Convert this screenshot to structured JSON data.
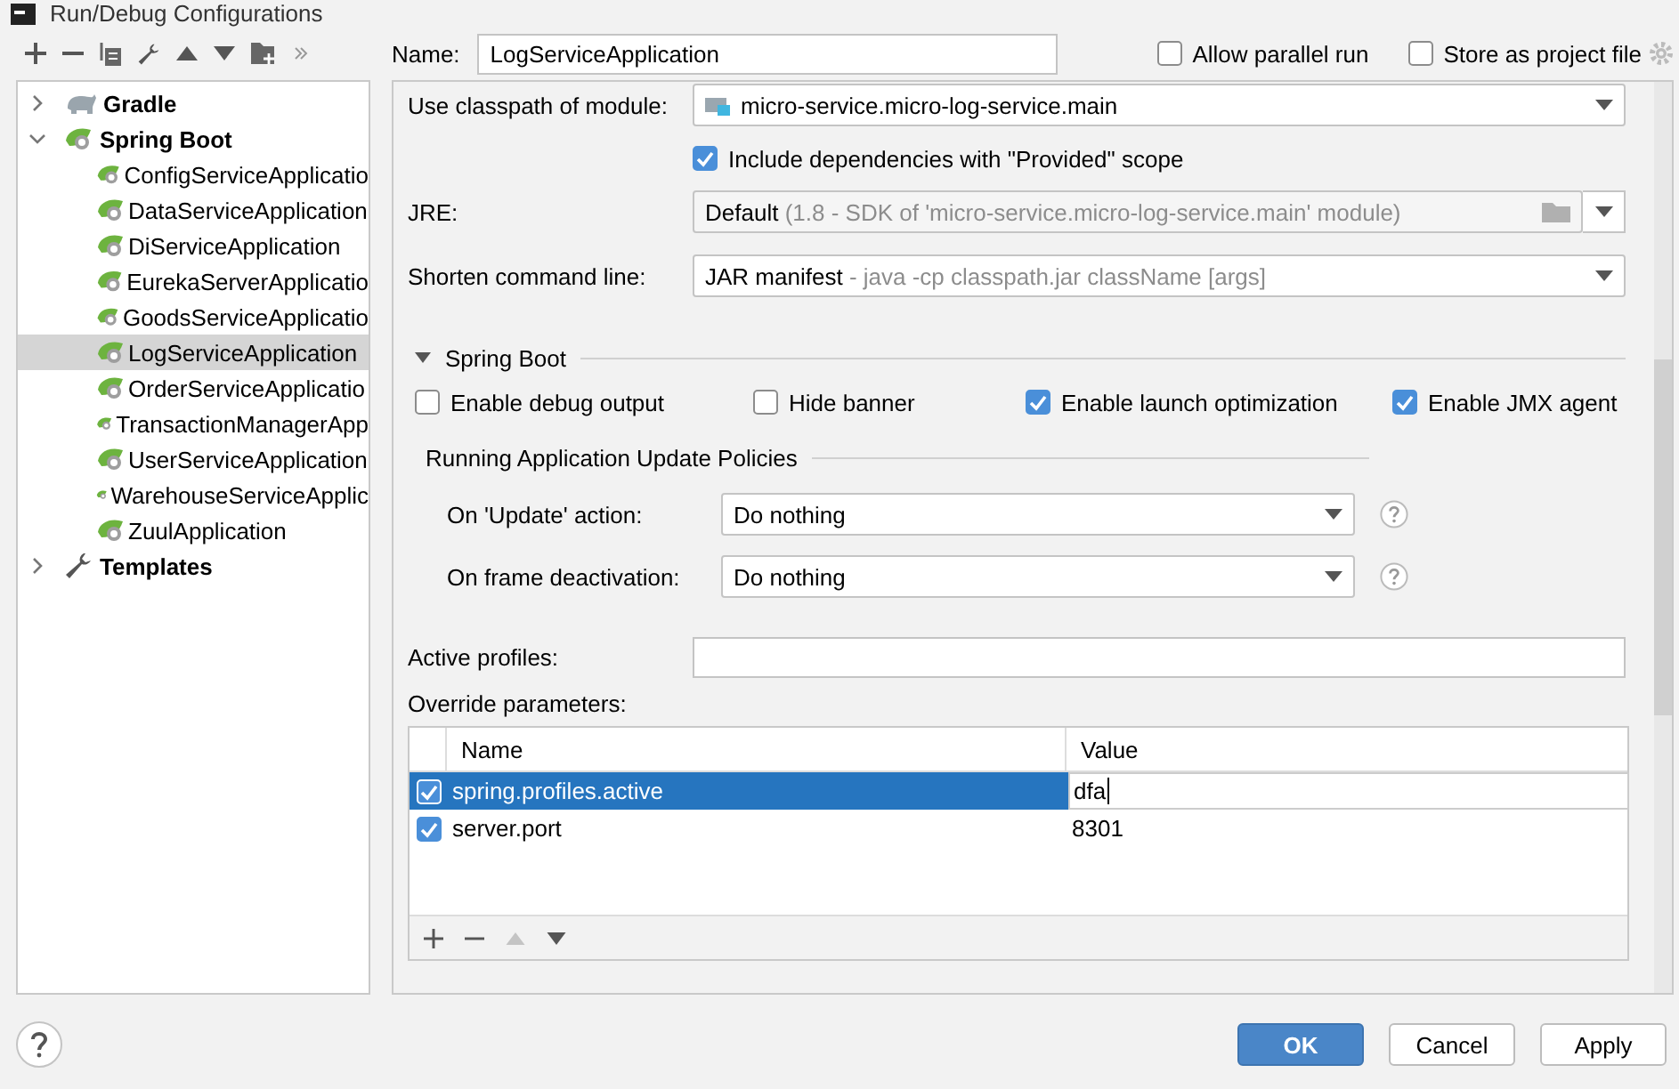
{
  "window": {
    "title": "Run/Debug Configurations"
  },
  "tree": {
    "items": [
      {
        "label": "Gradle",
        "kind": "gradle",
        "expanded": false,
        "selected": false
      },
      {
        "label": "Spring Boot",
        "kind": "spring",
        "expanded": true,
        "selected": false,
        "children": [
          {
            "label": "ConfigServiceApplicatio",
            "kind": "app",
            "selected": false
          },
          {
            "label": "DataServiceApplication",
            "kind": "app",
            "selected": false
          },
          {
            "label": "DiServiceApplication",
            "kind": "app",
            "selected": false
          },
          {
            "label": "EurekaServerApplicatio",
            "kind": "app",
            "selected": false
          },
          {
            "label": "GoodsServiceApplicatio",
            "kind": "app",
            "selected": false
          },
          {
            "label": "LogServiceApplication",
            "kind": "app",
            "selected": true
          },
          {
            "label": "OrderServiceApplicatio",
            "kind": "app",
            "selected": false
          },
          {
            "label": "TransactionManagerApp",
            "kind": "app",
            "selected": false
          },
          {
            "label": "UserServiceApplication",
            "kind": "app",
            "selected": false
          },
          {
            "label": "WarehouseServiceApplic",
            "kind": "app",
            "selected": false
          },
          {
            "label": "ZuulApplication",
            "kind": "app",
            "selected": false
          }
        ]
      },
      {
        "label": "Templates",
        "kind": "templates",
        "expanded": false,
        "selected": false
      }
    ]
  },
  "name_field": {
    "label": "Name:",
    "value": "LogServiceApplication"
  },
  "header_options": [
    {
      "label": "Allow parallel run",
      "checked": false
    },
    {
      "label": "Store as project file",
      "checked": false
    }
  ],
  "module": {
    "label": "Use classpath of module:",
    "value": "micro-service.micro-log-service.main"
  },
  "include_dependencies": {
    "label": "Include dependencies with \"Provided\" scope",
    "checked": true
  },
  "jre": {
    "label": "JRE:",
    "value": "Default",
    "hint": "(1.8 - SDK of 'micro-service.micro-log-service.main' module)"
  },
  "shorten_command_line": {
    "label": "Shorten command line:",
    "value": "JAR manifest",
    "hint": "- java -cp classpath.jar className [args]"
  },
  "spring_boot": {
    "title": "Spring Boot",
    "expanded": true,
    "options": [
      {
        "label": "Enable debug output",
        "checked": false
      },
      {
        "label": "Hide banner",
        "checked": false
      },
      {
        "label": "Enable launch optimization",
        "checked": true
      },
      {
        "label": "Enable JMX agent",
        "checked": true
      }
    ]
  },
  "update_policies": {
    "title": "Running Application Update Policies",
    "rows": [
      {
        "label": "On 'Update' action:",
        "value": "Do nothing"
      },
      {
        "label": "On frame deactivation:",
        "value": "Do nothing"
      }
    ]
  },
  "active_profiles": {
    "label": "Active profiles:"
  },
  "override_parameters": {
    "label": "Override parameters:",
    "columns": [
      "Name",
      "Value"
    ],
    "rows": [
      {
        "checked": true,
        "name": "spring.profiles.active",
        "value": "dfa",
        "selected": true
      },
      {
        "checked": true,
        "name": "server.port",
        "value": "8301",
        "selected": false
      }
    ]
  },
  "buttons": [
    {
      "label": "OK",
      "kind": "primary"
    },
    {
      "label": "Cancel",
      "kind": "normal"
    },
    {
      "label": "Apply",
      "kind": "normal"
    }
  ]
}
